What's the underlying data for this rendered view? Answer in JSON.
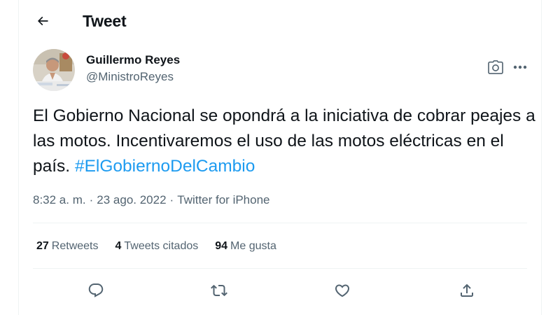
{
  "header": {
    "title": "Tweet",
    "back_icon": "arrow-left-icon"
  },
  "tweet": {
    "author": {
      "name": "Guillermo Reyes",
      "handle": "@MinistroReyes",
      "avatar_icon": "profile-photo"
    },
    "text_plain": "El Gobierno Nacional se opondrá a la iniciativa de cobrar peajes a las motos. Incentivaremos el uso de las motos eléctricas en el país. ",
    "hashtag": "#ElGobiernoDelCambio",
    "time": "8:32 a. m.",
    "date": "23 ago. 2022",
    "source": "Twitter for iPhone",
    "separator": "·",
    "top_actions": [
      "camera-icon",
      "more-icon"
    ]
  },
  "stats": {
    "retweets": {
      "count": "27",
      "label": "Retweets"
    },
    "quotes": {
      "count": "4",
      "label": "Tweets citados"
    },
    "likes": {
      "count": "94",
      "label": "Me gusta"
    }
  },
  "actions": [
    "reply-icon",
    "retweet-icon",
    "like-icon",
    "share-icon"
  ],
  "colors": {
    "accent": "#1d9bf0",
    "text": "#0f1419",
    "secondary": "#536471",
    "divider": "#eff3f4"
  }
}
